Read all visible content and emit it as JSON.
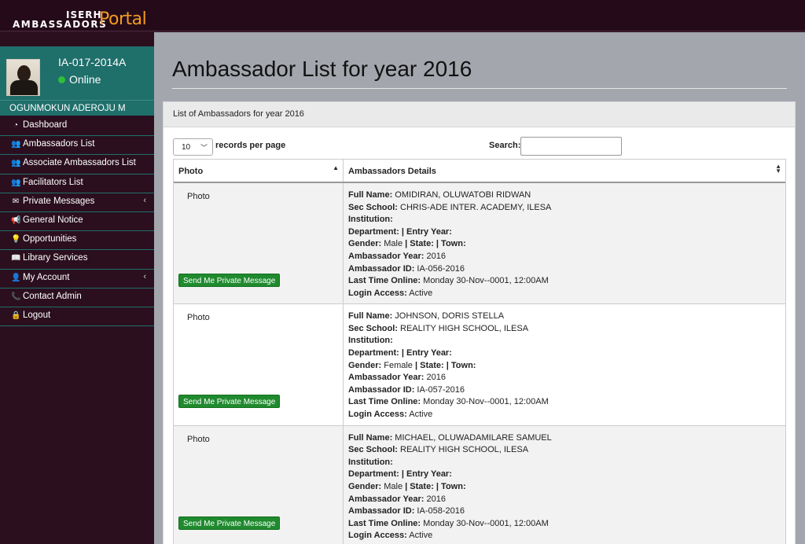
{
  "brand": {
    "line1": "ISERH",
    "line2": "AMBASSADORS",
    "portal": "Portal"
  },
  "colors": {
    "sidebar_bg": "#2b0f1e",
    "profile_teal": "#1f6f6b",
    "button_green": "#1f8a2e",
    "main_bg": "#a3a6ad",
    "logo_orange": "#f39b22"
  },
  "profile": {
    "id": "IA-017-2014A",
    "status": "Online",
    "name": "OGUNMOKUN ADEROJU M"
  },
  "menu": [
    {
      "label": "Dashboard",
      "icon": "dashboard-icon",
      "glyph": "◔"
    },
    {
      "label": "Ambassadors List",
      "icon": "users-icon",
      "glyph": "👥"
    },
    {
      "label": "Associate Ambassadors List",
      "icon": "users-icon",
      "glyph": "👥"
    },
    {
      "label": "Facilitators List",
      "icon": "users-icon",
      "glyph": "👥"
    },
    {
      "label": "Private Messages",
      "icon": "envelope-icon",
      "glyph": "✉",
      "chevron": "‹"
    },
    {
      "label": "General Notice",
      "icon": "bullhorn-icon",
      "glyph": "📢"
    },
    {
      "label": "Opportunities",
      "icon": "lightbulb-icon",
      "glyph": "💡"
    },
    {
      "label": "Library Services",
      "icon": "book-icon",
      "glyph": "📖"
    },
    {
      "label": "My Account",
      "icon": "user-icon",
      "glyph": "👤",
      "chevron": "‹"
    },
    {
      "label": "Contact Admin",
      "icon": "phone-icon",
      "glyph": "📞"
    },
    {
      "label": "Logout",
      "icon": "lock-icon",
      "glyph": "🔒"
    }
  ],
  "page": {
    "title": "Ambassador List for year 2016",
    "panel_title": "List of Ambassadors for year 2016"
  },
  "table_controls": {
    "page_length": "10",
    "length_label": "records per page",
    "search_label": "Search:",
    "search_value": ""
  },
  "table": {
    "columns": [
      "Photo",
      "Ambassadors Details"
    ],
    "button_label": "Send Me Private Message",
    "rows": [
      {
        "photo": "Photo",
        "full_name": "OMIDIRAN, OLUWATOBI RIDWAN",
        "sec_school": "CHRIS-ADE INTER. ACADEMY, ILESA",
        "institution": "",
        "department": "",
        "entry_year": "",
        "gender": "Male",
        "state": "",
        "town": "",
        "ambassador_year": "2016",
        "ambassador_id": "IA-056-2016",
        "last_online": "Monday 30-Nov--0001, 12:00AM",
        "login_access": "Active"
      },
      {
        "photo": "Photo",
        "full_name": "JOHNSON, DORIS STELLA",
        "sec_school": "REALITY HIGH SCHOOL, ILESA",
        "institution": "",
        "department": "",
        "entry_year": "",
        "gender": "Female",
        "state": "",
        "town": "",
        "ambassador_year": "2016",
        "ambassador_id": "IA-057-2016",
        "last_online": "Monday 30-Nov--0001, 12:00AM",
        "login_access": "Active"
      },
      {
        "photo": "Photo",
        "full_name": "MICHAEL, OLUWADAMILARE SAMUEL",
        "sec_school": "REALITY HIGH SCHOOL, ILESA",
        "institution": "",
        "department": "",
        "entry_year": "",
        "gender": "Male",
        "state": "",
        "town": "",
        "ambassador_year": "2016",
        "ambassador_id": "IA-058-2016",
        "last_online": "Monday 30-Nov--0001, 12:00AM",
        "login_access": "Active"
      }
    ]
  }
}
